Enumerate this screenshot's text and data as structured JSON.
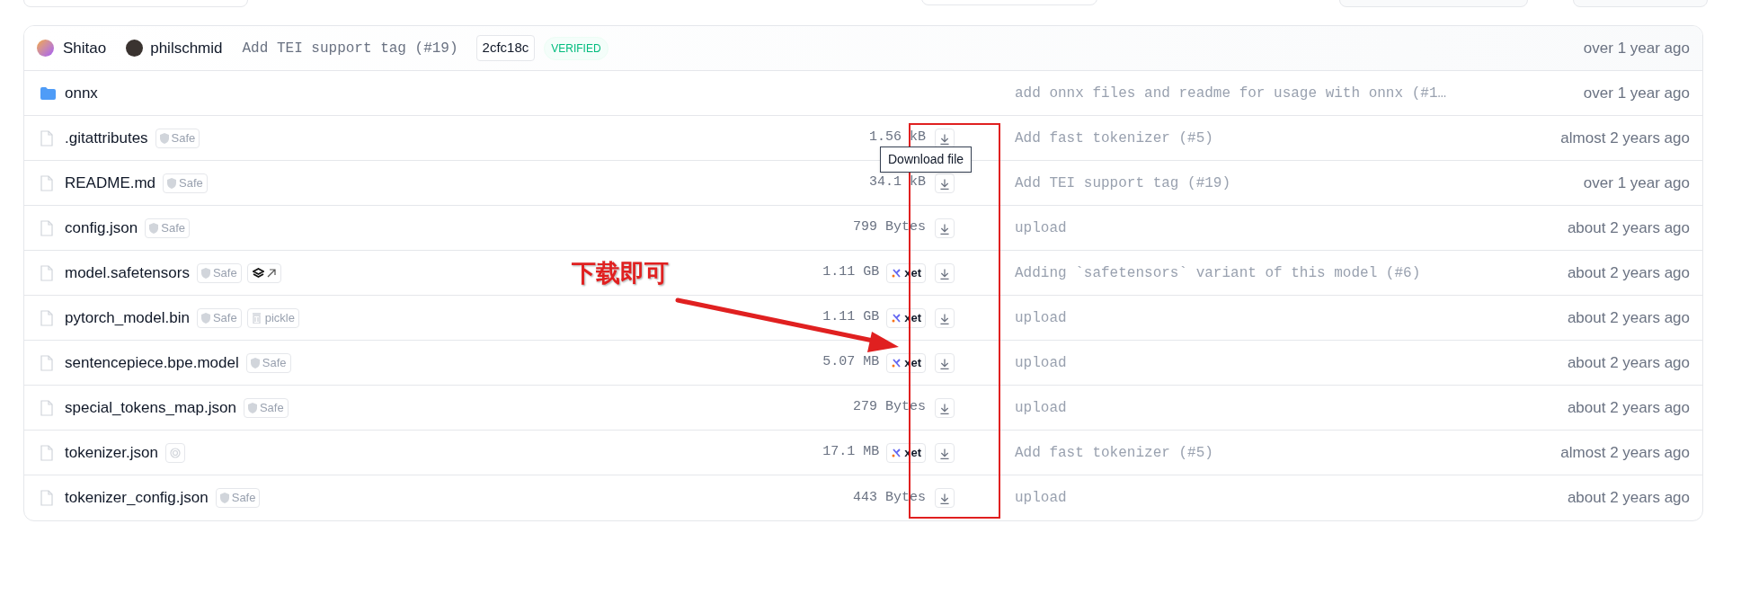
{
  "commit": {
    "authors": [
      {
        "name": "Shitao"
      },
      {
        "name": "philschmid"
      }
    ],
    "message": "Add TEI support tag (#19)",
    "hash": "2cfc18c",
    "verified": "VERIFIED",
    "time": "over 1 year ago"
  },
  "files": [
    {
      "kind": "folder",
      "name": "onnx",
      "message": "add onnx files and readme for usage with onnx (#1…",
      "time": "over 1 year ago"
    },
    {
      "kind": "file",
      "name": ".gitattributes",
      "badges": [
        {
          "kind": "safe",
          "label": "Safe"
        }
      ],
      "size": "1.56 kB",
      "tooltip": "Download file",
      "message": "Add fast tokenizer (#5)",
      "time": "almost 2 years ago"
    },
    {
      "kind": "file",
      "name": "README.md",
      "badges": [
        {
          "kind": "safe",
          "label": "Safe"
        }
      ],
      "size": "34.1 kB",
      "message": "Add TEI support tag (#19)",
      "time": "over 1 year ago"
    },
    {
      "kind": "file",
      "name": "config.json",
      "badges": [
        {
          "kind": "safe",
          "label": "Safe"
        }
      ],
      "size": "799 Bytes",
      "message": "upload",
      "time": "about 2 years ago"
    },
    {
      "kind": "file",
      "name": "model.safetensors",
      "badges": [
        {
          "kind": "safe",
          "label": "Safe"
        },
        {
          "kind": "layers"
        }
      ],
      "size": "1.11 GB",
      "storage": "xet",
      "message": "Adding `safetensors` variant of this model (#6)",
      "time": "about 2 years ago"
    },
    {
      "kind": "file",
      "name": "pytorch_model.bin",
      "badges": [
        {
          "kind": "safe",
          "label": "Safe"
        },
        {
          "kind": "pickle",
          "label": "pickle"
        }
      ],
      "size": "1.11 GB",
      "storage": "xet",
      "message": "upload",
      "time": "about 2 years ago"
    },
    {
      "kind": "file",
      "name": "sentencepiece.bpe.model",
      "badges": [
        {
          "kind": "safe",
          "label": "Safe"
        }
      ],
      "size": "5.07 MB",
      "storage": "xet",
      "message": "upload",
      "time": "about 2 years ago"
    },
    {
      "kind": "file",
      "name": "special_tokens_map.json",
      "badges": [
        {
          "kind": "safe",
          "label": "Safe"
        }
      ],
      "size": "279 Bytes",
      "message": "upload",
      "time": "about 2 years ago"
    },
    {
      "kind": "file",
      "name": "tokenizer.json",
      "badges": [
        {
          "kind": "scan"
        }
      ],
      "size": "17.1 MB",
      "storage": "xet",
      "message": "Add fast tokenizer (#5)",
      "time": "almost 2 years ago"
    },
    {
      "kind": "file",
      "name": "tokenizer_config.json",
      "badges": [
        {
          "kind": "safe",
          "label": "Safe"
        }
      ],
      "size": "443 Bytes",
      "message": "upload",
      "time": "about 2 years ago"
    }
  ],
  "annotation": {
    "text": "下载即可"
  }
}
